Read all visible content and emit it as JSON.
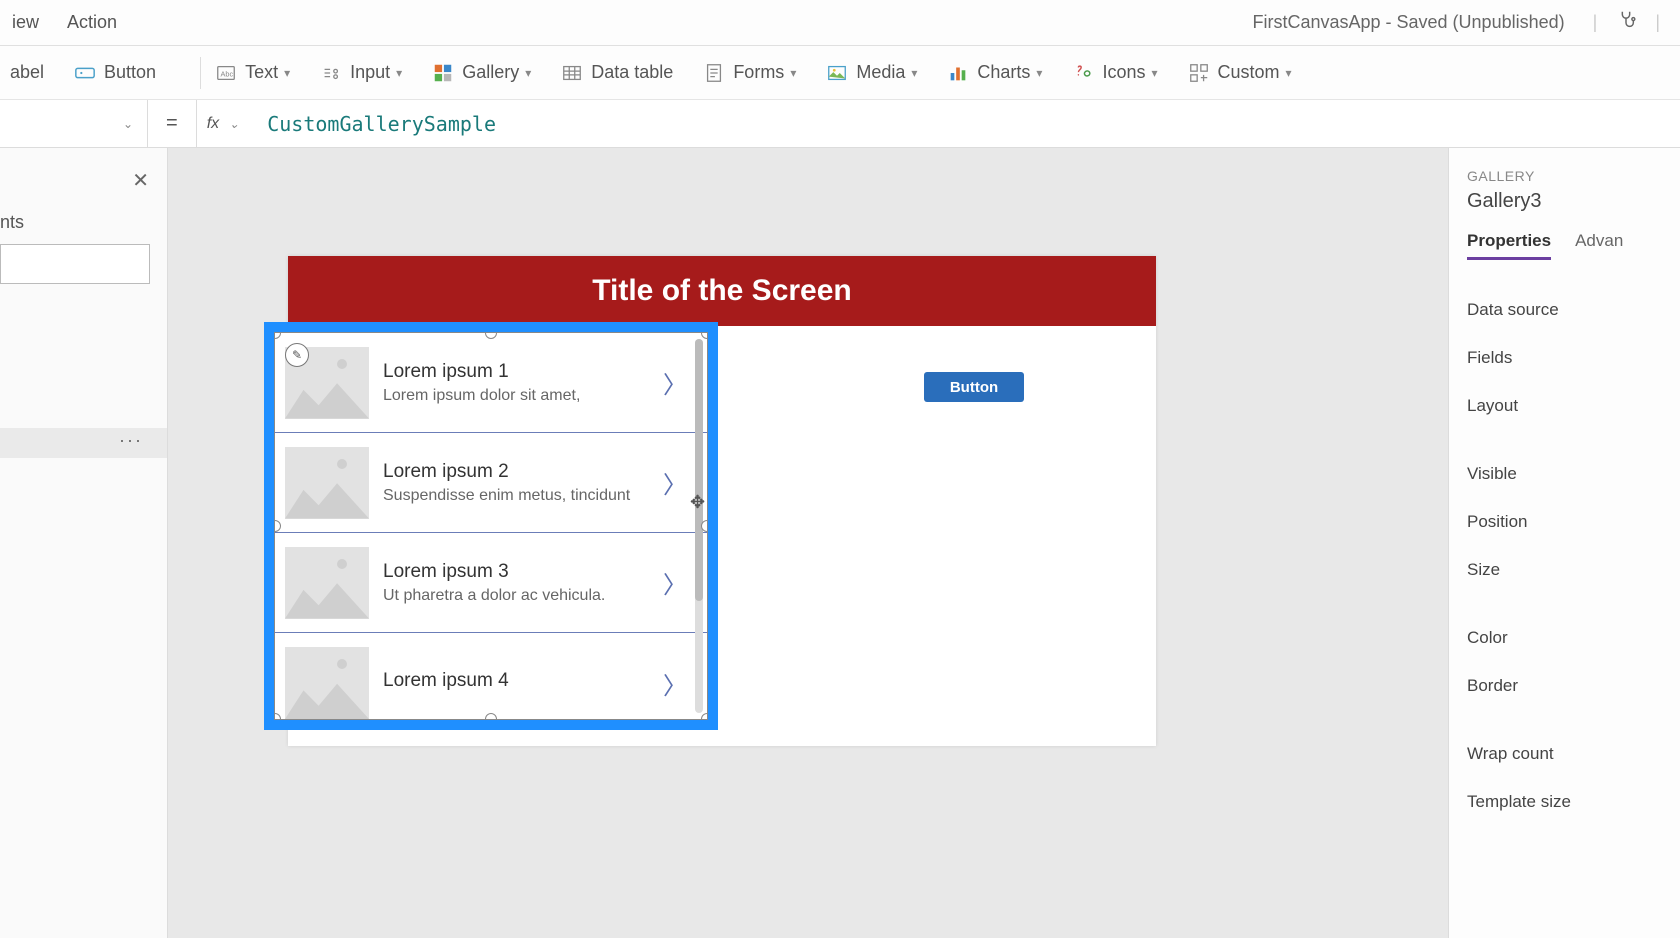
{
  "top": {
    "menu": [
      "iew",
      "Action"
    ],
    "appState": "FirstCanvasApp - Saved (Unpublished)"
  },
  "ribbon": {
    "label": "abel",
    "button": "Button",
    "text": "Text",
    "input": "Input",
    "gallery": "Gallery",
    "dataTable": "Data table",
    "forms": "Forms",
    "media": "Media",
    "charts": "Charts",
    "icons": "Icons",
    "custom": "Custom"
  },
  "formula": {
    "value": "CustomGallerySample"
  },
  "leftPane": {
    "label": "nts",
    "dots": "···"
  },
  "screen": {
    "headerTitle": "Title of the Screen",
    "buttonLabel": "Button"
  },
  "gallery": {
    "items": [
      {
        "title": "Lorem ipsum 1",
        "sub": "Lorem ipsum dolor sit amet,"
      },
      {
        "title": "Lorem ipsum 2",
        "sub": "Suspendisse enim metus, tincidunt"
      },
      {
        "title": "Lorem ipsum 3",
        "sub": "Ut pharetra a dolor ac vehicula."
      },
      {
        "title": "Lorem ipsum 4",
        "sub": ""
      }
    ]
  },
  "rightPane": {
    "typeLabel": "Gallery",
    "name": "Gallery3",
    "tabs": {
      "properties": "Properties",
      "advanced": "Advan"
    },
    "props": {
      "dataSource": "Data source",
      "fields": "Fields",
      "layout": "Layout",
      "visible": "Visible",
      "position": "Position",
      "size": "Size",
      "color": "Color",
      "border": "Border",
      "wrapCount": "Wrap count",
      "templateSize": "Template size"
    }
  }
}
